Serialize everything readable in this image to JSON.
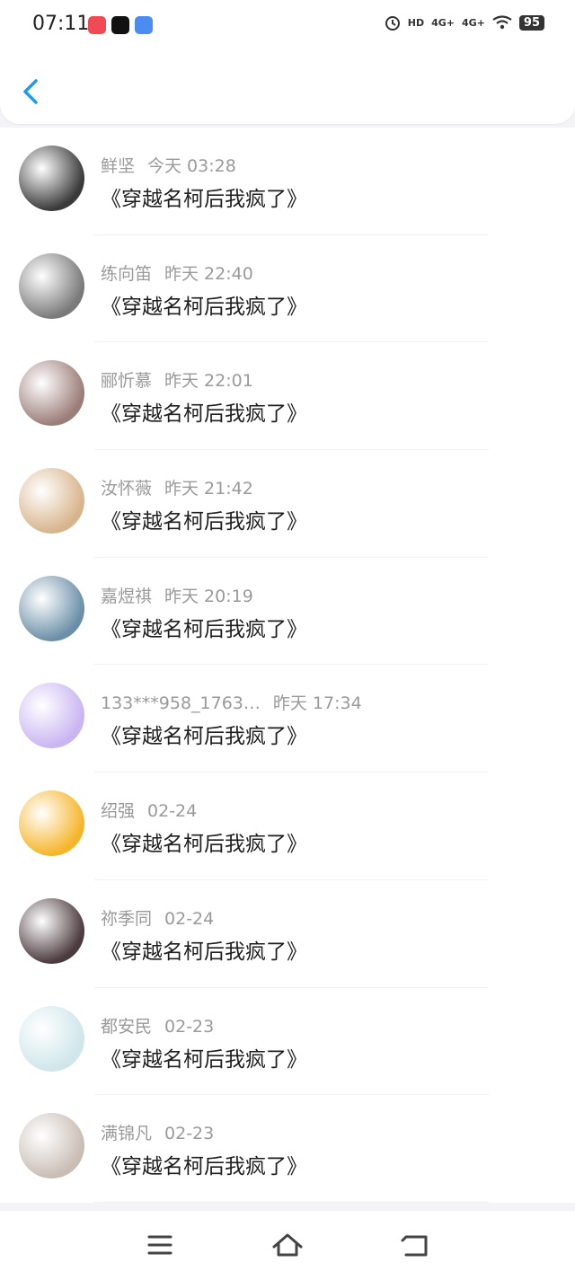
{
  "status_bar": {
    "time": "07:11",
    "network_1": "4G+",
    "network_2": "4G+",
    "hd": "HD",
    "battery": "95"
  },
  "header": {
    "back_icon": "chevron-left-icon",
    "accent_color": "#1e9be9"
  },
  "messages": [
    {
      "name": "鲜坚",
      "time": "今天 03:28",
      "text": "《穿越名柯后我疯了》",
      "avatar_color": "#3a3a3a"
    },
    {
      "name": "练向笛",
      "time": "昨天 22:40",
      "text": "《穿越名柯后我疯了》",
      "avatar_color": "#7a7a7a"
    },
    {
      "name": "郦忻慕",
      "time": "昨天 22:01",
      "text": "《穿越名柯后我疯了》",
      "avatar_color": "#9b7d78"
    },
    {
      "name": "汝怀薇",
      "time": "昨天 21:42",
      "text": "《穿越名柯后我疯了》",
      "avatar_color": "#d8b48c"
    },
    {
      "name": "嘉煜祺",
      "time": "昨天 20:19",
      "text": "《穿越名柯后我疯了》",
      "avatar_color": "#6b8fa8"
    },
    {
      "name": "133***958_1763…",
      "time": "昨天 17:34",
      "text": "《穿越名柯后我疯了》",
      "avatar_color": "#c9b5f2"
    },
    {
      "name": "绍强",
      "time": "02-24",
      "text": "《穿越名柯后我疯了》",
      "avatar_color": "#f5b52a"
    },
    {
      "name": "祢季同",
      "time": "02-24",
      "text": "《穿越名柯后我疯了》",
      "avatar_color": "#4b3a3e"
    },
    {
      "name": "都安民",
      "time": "02-23",
      "text": "《穿越名柯后我疯了》",
      "avatar_color": "#cfe6ea"
    },
    {
      "name": "满锦凡",
      "time": "02-23",
      "text": "《穿越名柯后我疯了》",
      "avatar_color": "#c9bdb4"
    }
  ],
  "nav_bar": {
    "menu_icon": "menu-icon",
    "home_icon": "home-icon",
    "back_icon": "back-icon"
  }
}
